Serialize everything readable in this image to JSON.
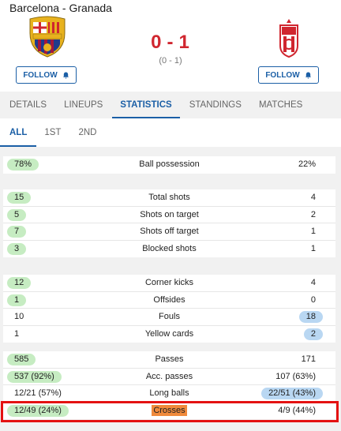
{
  "header": {
    "title": "Barcelona - Granada",
    "home_team": "Barcelona",
    "away_team": "Granada",
    "score_home": "0",
    "score_sep": "-",
    "score_away": "1",
    "halftime": "(0 - 1)",
    "follow_label": "FOLLOW",
    "score_color": "#d0262f"
  },
  "tabs": [
    "DETAILS",
    "LINEUPS",
    "STATISTICS",
    "STANDINGS",
    "MATCHES"
  ],
  "active_tab": "STATISTICS",
  "subtabs": [
    "ALL",
    "1ST",
    "2ND"
  ],
  "active_subtab": "ALL",
  "colors": {
    "accent": "#1b5fa6",
    "home_highlight": "#c6ecc2",
    "away_highlight": "#b9d7f2",
    "selection_frame": "#e41212",
    "label_highlight": "#f08a3c"
  },
  "stats": [
    [
      {
        "label": "Ball possession",
        "home": "78%",
        "away": "22%",
        "leader": "home"
      }
    ],
    [
      {
        "label": "Total shots",
        "home": "15",
        "away": "4",
        "leader": "home"
      },
      {
        "label": "Shots on target",
        "home": "5",
        "away": "2",
        "leader": "home"
      },
      {
        "label": "Shots off target",
        "home": "7",
        "away": "1",
        "leader": "home"
      },
      {
        "label": "Blocked shots",
        "home": "3",
        "away": "1",
        "leader": "home"
      }
    ],
    [
      {
        "label": "Corner kicks",
        "home": "12",
        "away": "4",
        "leader": "home"
      },
      {
        "label": "Offsides",
        "home": "1",
        "away": "0",
        "leader": "home"
      },
      {
        "label": "Fouls",
        "home": "10",
        "away": "18",
        "leader": "away"
      },
      {
        "label": "Yellow cards",
        "home": "1",
        "away": "2",
        "leader": "away"
      }
    ],
    [
      {
        "label": "Passes",
        "home": "585",
        "away": "171",
        "leader": "home"
      },
      {
        "label": "Acc. passes",
        "home": "537 (92%)",
        "away": "107 (63%)",
        "leader": "home"
      },
      {
        "label": "Long balls",
        "home": "12/21 (57%)",
        "away": "22/51 (43%)",
        "leader": "away"
      },
      {
        "label": "Crosses",
        "home": "12/49 (24%)",
        "away": "4/9 (44%)",
        "leader": "home",
        "highlighted": true
      }
    ]
  ]
}
